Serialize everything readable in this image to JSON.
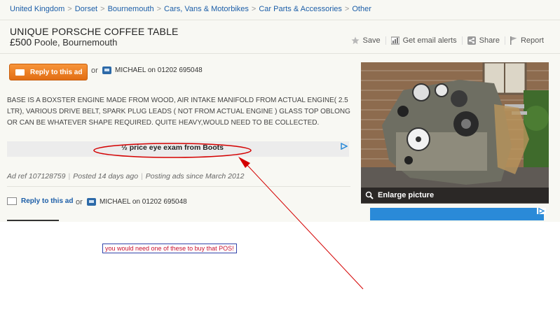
{
  "breadcrumb": {
    "items": [
      "United Kingdom",
      "Dorset",
      "Bournemouth",
      "Cars, Vans & Motorbikes",
      "Car Parts & Accessories",
      "Other"
    ],
    "separator": ">"
  },
  "listing": {
    "title": "UNIQUE PORSCHE COFFEE TABLE",
    "price": "£500",
    "location": "Poole, Bournemouth",
    "description": "BASE IS A BOXSTER ENGINE MADE FROM WOOD, AIR INTAKE MANIFOLD FROM ACTUAL ENGINE( 2.5 LTR), VARIOUS DRIVE BELT, SPARK PLUG LEADS ( NOT FROM ACTUAL ENGINE ) GLASS TOP OBLONG OR CAN BE WHATEVER SHAPE REQUIRED. QUITE HEAVY,WOULD NEED TO BE COLLECTED.",
    "ad_ref": "Ad ref 107128759",
    "posted": "Posted 14 days ago",
    "posting_since": "Posting ads since March 2012"
  },
  "actions": {
    "save": "Save",
    "email_alerts": "Get email alerts",
    "share": "Share",
    "report": "Report"
  },
  "contact": {
    "reply_button": "Reply to this ad",
    "or": "or",
    "phone": "MICHAEL on 01202 695048",
    "reply_link": "Reply to this ad"
  },
  "ad_banner": {
    "text": "½ price eye exam from Boots",
    "choice_icon": "adchoices-icon"
  },
  "image": {
    "enlarge_label": "Enlarge picture"
  },
  "annotation": {
    "caption": "you would need one of these to buy that POS!",
    "color": "#d40000"
  },
  "colors": {
    "link": "#1c5ea8",
    "reply_orange": "#f08a2c",
    "annotation_red": "#d40000"
  }
}
